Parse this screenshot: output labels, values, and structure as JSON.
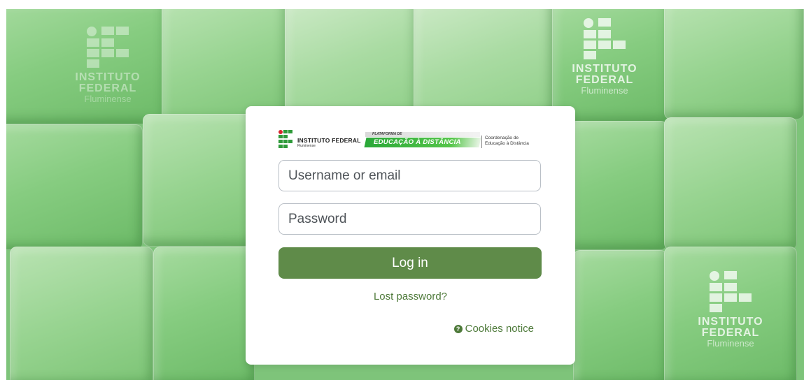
{
  "background": {
    "watermark_title_line1": "INSTITUTO",
    "watermark_title_line2": "FEDERAL",
    "watermark_subtitle": "Fluminense",
    "color": "#7ec47a"
  },
  "header": {
    "institution_name": "INSTITUTO FEDERAL",
    "institution_campus": "Fluminense",
    "platform_prefix": "PLATAFORMA DE",
    "platform_name": "EDUCAÇÃO À DISTÂNCIA",
    "coordination_line1": "Coordenação de",
    "coordination_line2": "Educação à Distância"
  },
  "login": {
    "username_placeholder": "Username or email",
    "username_value": "",
    "password_placeholder": "Password",
    "password_value": "",
    "login_button": "Log in",
    "lost_password": "Lost password?",
    "cookies_notice": "Cookies notice",
    "accent_color": "#5f8b49"
  }
}
